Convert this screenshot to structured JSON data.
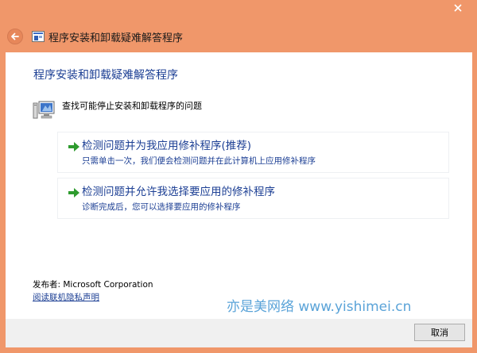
{
  "window": {
    "title": "程序安装和卸载疑难解答程序"
  },
  "content": {
    "heading": "程序安装和卸载疑难解答程序",
    "problem": "查找可能停止安装和卸载程序的问题",
    "options": [
      {
        "title": "检测问题并为我应用修补程序(推荐)",
        "description": "只需单击一次，我们便会检测问题并在此计算机上应用修补程序",
        "icon": "green-arrow-icon"
      },
      {
        "title": "检测问题并允许我选择要应用的修补程序",
        "description": "诊断完成后，您可以选择要应用的修补程序",
        "icon": "green-arrow-icon"
      }
    ],
    "publisher": "发布者: Microsoft Corporation",
    "privacy_link": "阅读联机隐私声明",
    "watermark": "亦是美网络 www.yishimei.cn"
  },
  "footer": {
    "cancel_label": "取消"
  },
  "colors": {
    "frame": "#f0976a",
    "link_blue": "#1c3f94",
    "arrow_green": "#2e9b2e",
    "watermark": "#5aa3d8"
  }
}
